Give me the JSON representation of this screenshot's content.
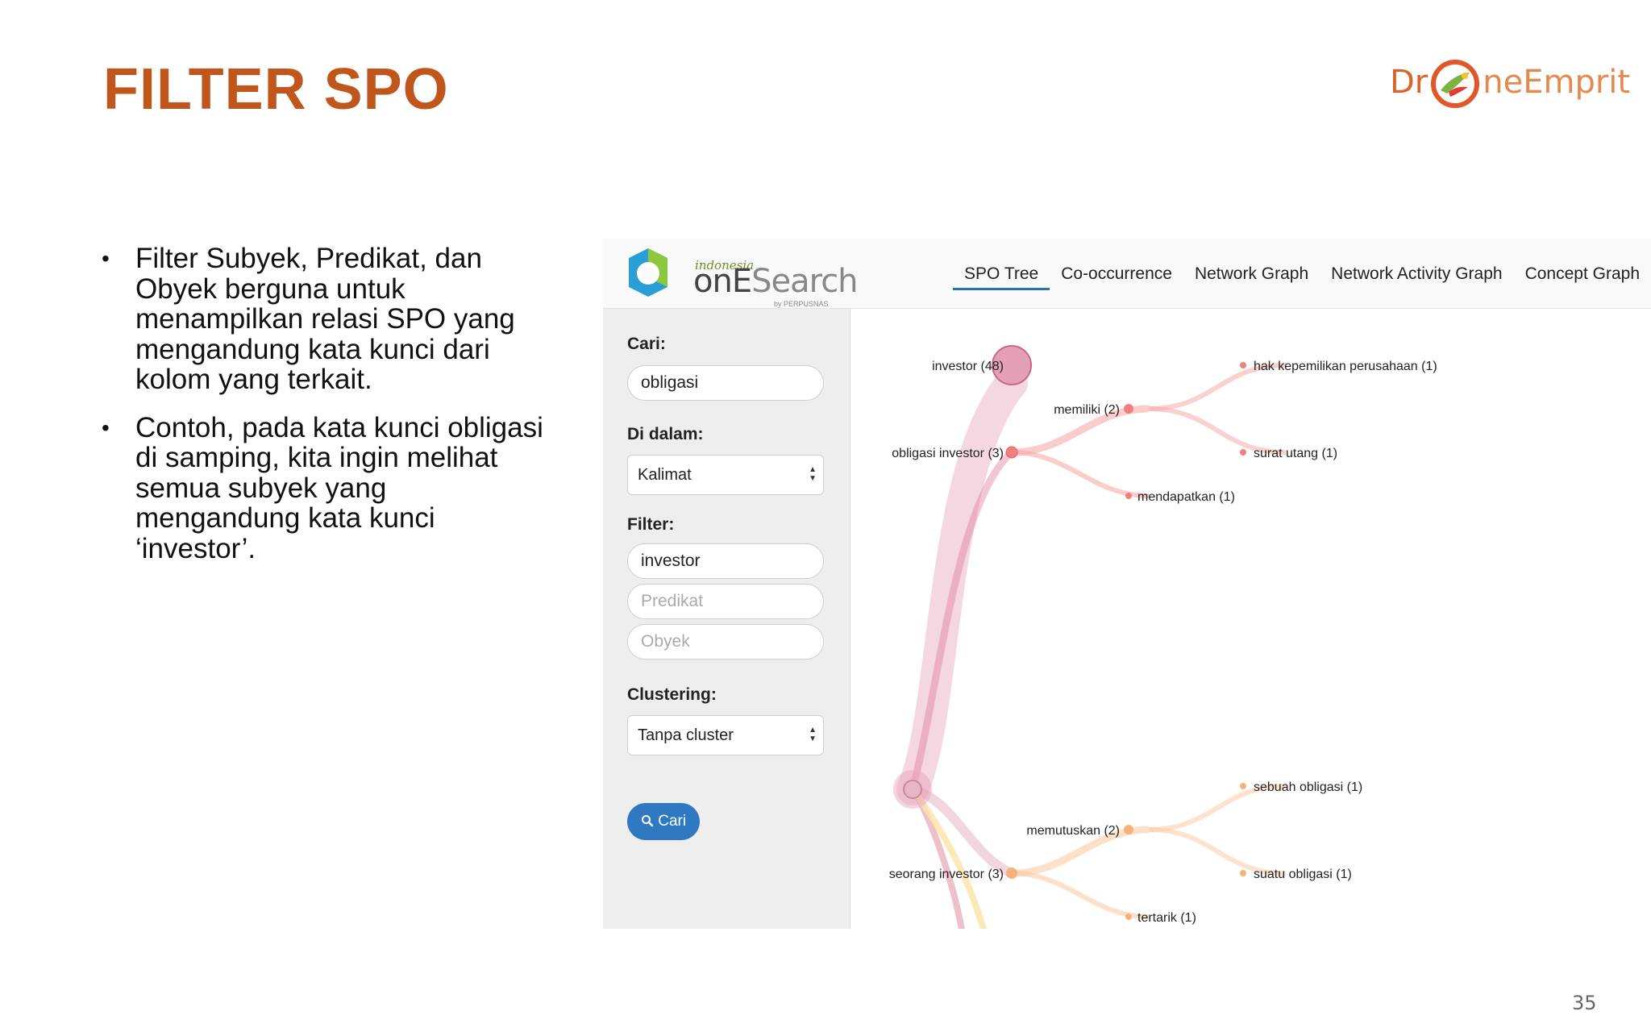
{
  "slide": {
    "title": "FILTER SPO",
    "page_number": "35",
    "bullets": [
      "Filter Subyek, Predikat, dan Obyek berguna untuk menampilkan relasi SPO yang mengandung kata kunci dari kolom yang terkait.",
      "Contoh, pada kata kunci obligasi di samping, kita ingin melihat semua subyek yang mengandung kata kunci ‘investor’."
    ]
  },
  "logo": {
    "part1": "Dr",
    "part2": "ne",
    "part3": "Emprit"
  },
  "app": {
    "brand_small": "indonesia",
    "brand_main_bold": "onE",
    "brand_main_thin": "Search",
    "brand_by": "by PERPUSNAS",
    "tabs": [
      "SPO Tree",
      "Co-occurrence",
      "Network Graph",
      "Network Activity Graph",
      "Concept Graph"
    ],
    "colors": {
      "accent": "#2c6fb5",
      "title": "#c0561c",
      "red_branch": "#f08080",
      "orange_branch": "#f7b27a"
    }
  },
  "sidebar": {
    "cari_label": "Cari:",
    "cari_value": "obligasi",
    "didalam_label": "Di dalam:",
    "didalam_value": "Kalimat",
    "filter_label": "Filter:",
    "filter_subyek_value": "investor",
    "filter_predikat_placeholder": "Predikat",
    "filter_obyek_placeholder": "Obyek",
    "clustering_label": "Clustering:",
    "clustering_value": "Tanpa cluster",
    "button_label": "Cari"
  },
  "tree": {
    "investor": "investor (48)",
    "obligasi_investor": "obligasi investor (3)",
    "memiliki": "memiliki (2)",
    "hak_kepemilikan": "hak kepemilikan perusahaan (1)",
    "surat_utang": "surat utang (1)",
    "mendapatkan": "mendapatkan (1)",
    "seorang_investor": "seorang investor (3)",
    "memutuskan": "memutuskan (2)",
    "sebuah_obligasi": "sebuah obligasi (1)",
    "suatu_obligasi": "suatu obligasi (1)",
    "tertarik": "tertarik (1)"
  }
}
